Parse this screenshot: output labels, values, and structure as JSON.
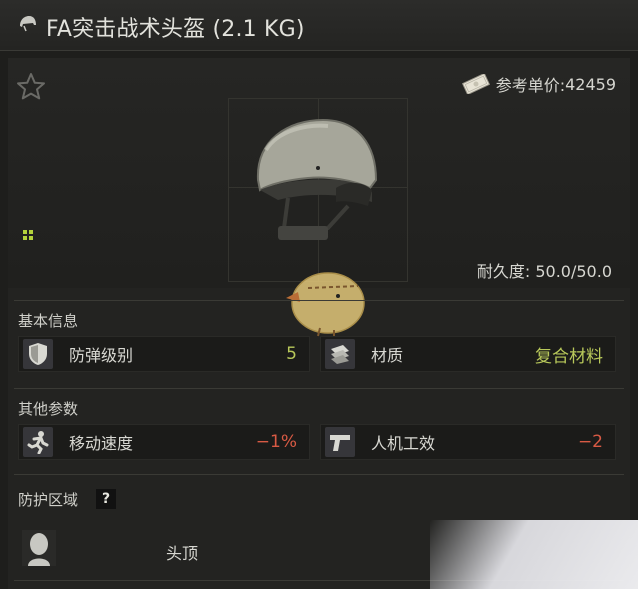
{
  "title": "FA突击战术头盔 (2.1 KG)",
  "price": {
    "label": "参考单价:",
    "value": "42459"
  },
  "durability": {
    "label": "耐久度:",
    "value": "50.0/50.0"
  },
  "sections": {
    "basic": "基本信息",
    "other": "其他参数",
    "protection": "防护区域",
    "help": "?"
  },
  "basic_stats": [
    {
      "label": "防弹级别",
      "value": "5",
      "tone": "good",
      "icon": "shield-icon"
    },
    {
      "label": "材质",
      "value": "复合材料",
      "tone": "good",
      "icon": "material-icon"
    }
  ],
  "other_stats": [
    {
      "label": "移动速度",
      "value": "−1%",
      "tone": "bad",
      "icon": "running-icon"
    },
    {
      "label": "人机工效",
      "value": "−2",
      "tone": "bad",
      "icon": "pistol-icon"
    }
  ],
  "protection_zones": [
    {
      "label": "头顶",
      "icon": "head-icon"
    }
  ],
  "colors": {
    "positive": "#b8c85a",
    "negative": "#d85a44",
    "background": "#1e1e1c"
  }
}
